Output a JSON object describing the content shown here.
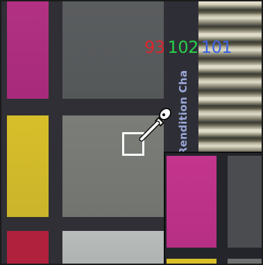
{
  "readout": {
    "r": "93",
    "g": "102",
    "b": "101",
    "r_color": "#e0242d",
    "g_color": "#28d04a",
    "b_color": "#3b63e6"
  },
  "chart_label": "Rendition Cha",
  "icons": {
    "picker": "eyedropper-icon",
    "sample": "sample-square"
  },
  "colors": {
    "magenta": "#b23182",
    "yellow": "#d7bf2a",
    "red": "#b0213e",
    "dark_gray": "#5a5d5f",
    "mid_gray": "#7b7e78",
    "light_gray": "#b8bcbb",
    "label_blue": "#9aa7d8"
  }
}
